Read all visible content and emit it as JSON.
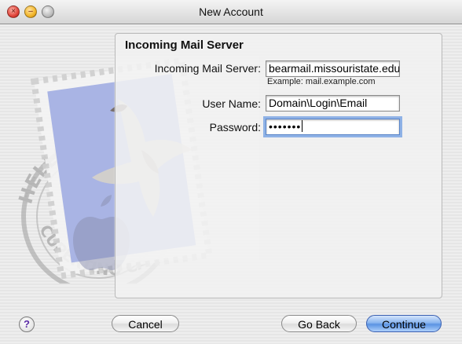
{
  "window": {
    "title": "New Account",
    "close_glyph": "×",
    "min_glyph": "–"
  },
  "background": {
    "stamp_text_top": "HELLO FR",
    "stamp_text_bottom": "CUPERTINO CA"
  },
  "panel": {
    "section_title": "Incoming Mail Server",
    "fields": {
      "server": {
        "label": "Incoming Mail Server:",
        "value": "bearmail.missouristate.edu"
      },
      "example": "Example: mail.example.com",
      "username": {
        "label": "User Name:",
        "value": "Domain\\Login\\Email"
      },
      "password": {
        "label": "Password:",
        "value": "•••••••"
      }
    }
  },
  "buttons": {
    "help": "?",
    "cancel": "Cancel",
    "go_back": "Go Back",
    "continue": "Continue"
  },
  "colors": {
    "accent": "#5a93e3",
    "help_purple": "#5b2ca6"
  }
}
